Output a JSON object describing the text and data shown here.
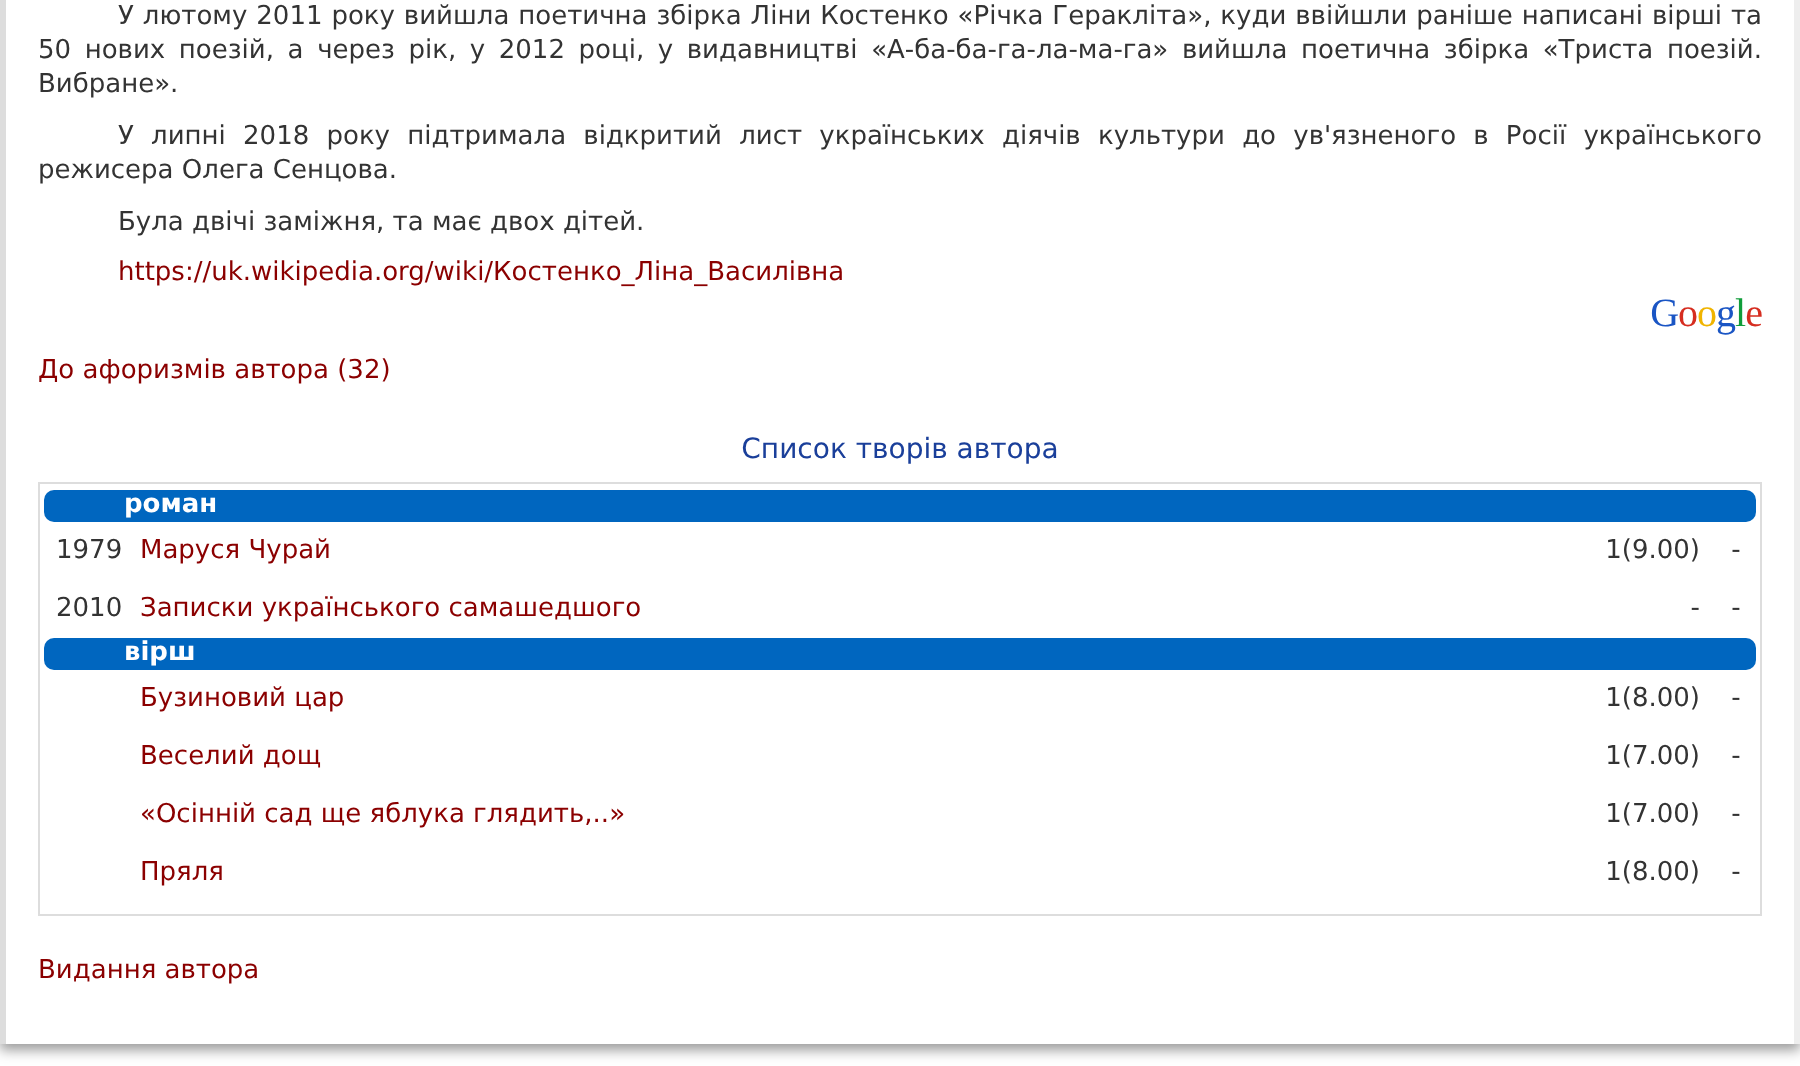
{
  "paragraphs": [
    "У лютому 2011 року вийшла поетична збірка Ліни Костенко «Річка Геракліта», куди ввійшли раніше написані вірші та 50 нових поезій, а через рік, у 2012 році, у видавництві «А-ба-ба-га-ла-ма-га» вийшла поетична збірка «Триста поезій. Вибране».",
    "У липні 2018 року підтримала відкритий лист українських діячів культури до ув'язненого в Росії українського режисера Олега Сенцова.",
    "Була двічі заміжня, та має двох дітей."
  ],
  "source_link": "https://uk.wikipedia.org/wiki/Костенко_Ліна_Василівна",
  "logo": "Google",
  "aphorisms_link": "До афоризмів автора (32)",
  "works": {
    "title": "Список творів автора",
    "groups": [
      {
        "name": "роман",
        "items": [
          {
            "year": "1979",
            "title": "Маруся Чурай",
            "rating": "1(9.00)",
            "extra": "-"
          },
          {
            "year": "2010",
            "title": "Записки українського самашедшого",
            "rating": "-",
            "extra": "-"
          }
        ]
      },
      {
        "name": "вірш",
        "items": [
          {
            "title": "Бузиновий цар",
            "rating": "1(8.00)",
            "extra": "-"
          },
          {
            "title": "Веселий дощ",
            "rating": "1(7.00)",
            "extra": "-"
          },
          {
            "title": "«Осінній сад ще яблука глядить,..»",
            "rating": "1(7.00)",
            "extra": "-"
          },
          {
            "title": "Пряля",
            "rating": "1(8.00)",
            "extra": "-"
          }
        ]
      }
    ]
  },
  "editions_link": "Видання автора"
}
